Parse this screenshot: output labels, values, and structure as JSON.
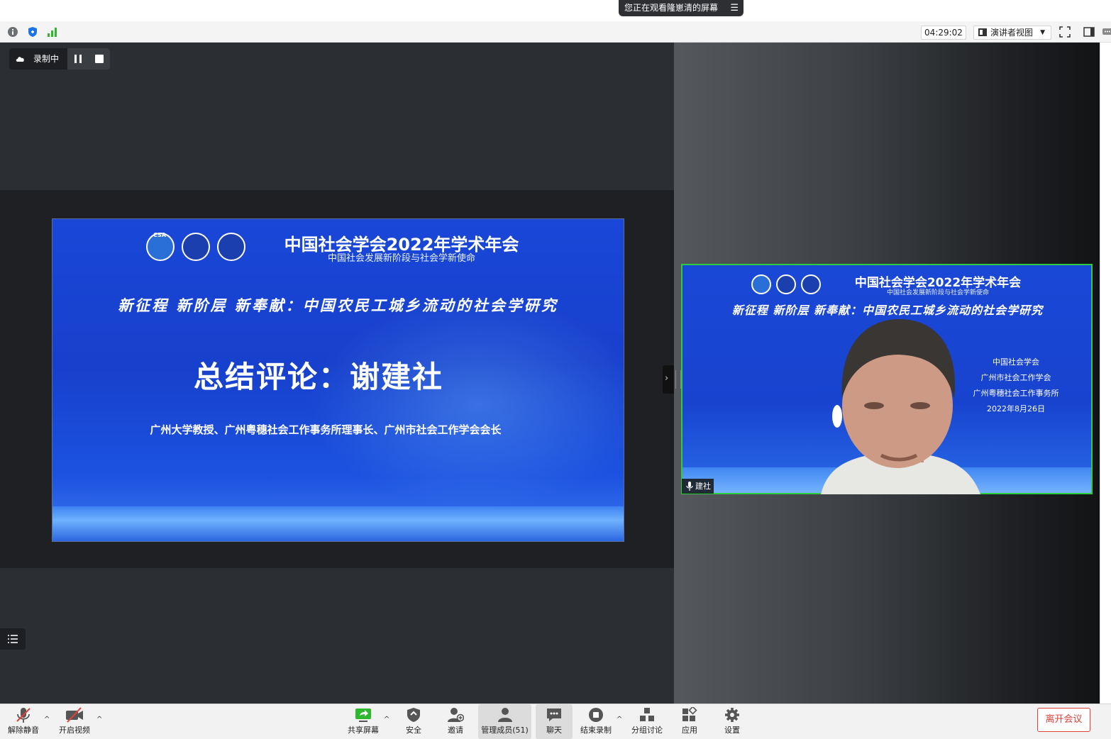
{
  "banner": {
    "sharing_text": "您正在观看隆崽清的屏幕",
    "menu_icon": "list-menu-icon"
  },
  "infobar": {
    "timer": "04:29:02",
    "view_label": "演讲者视图",
    "icons": [
      "info-icon",
      "shield-icon",
      "signal-icon",
      "fullscreen-icon",
      "side-panel-icon",
      "chat-bubble-icon"
    ]
  },
  "recording": {
    "label": "录制中",
    "icons": [
      "cloud-icon",
      "pause-icon",
      "stop-icon"
    ]
  },
  "slide": {
    "title": "中国社会学会2022年学术年会",
    "subtitle": "中国社会发展新阶段与社会学新使命",
    "logo_text": "CSA",
    "topic": "新征程 新阶层 新奉献：中国农民工城乡流动的社会学研究",
    "speaker": "总结评论：谢建社",
    "affiliation": "广州大学教授、广州粤穗社会工作事务所理事长、广州市社会工作学会会长"
  },
  "video": {
    "title": "中国社会学会2022年学术年会",
    "subtitle": "中国社会发展新阶段与社会学新使命",
    "topic": "新征程 新阶层 新奉献：中国农民工城乡流动的社会学研究",
    "orgs": [
      "中国社会学会",
      "广州市社会工作学会",
      "广州粤穗社会工作事务所",
      "2022年8月26日"
    ],
    "participant_name": "建社",
    "highlight_color": "#2ecc40"
  },
  "toolbar": {
    "mute": "解除静音",
    "video": "开启视频",
    "share": "共享屏幕",
    "security": "安全",
    "invite": "邀请",
    "participants": "管理成员(51)",
    "chat": "聊天",
    "end_record": "结束录制",
    "breakout": "分组讨论",
    "apps": "应用",
    "settings": "设置",
    "leave": "离开会议",
    "leave_color": "#e0403a"
  }
}
